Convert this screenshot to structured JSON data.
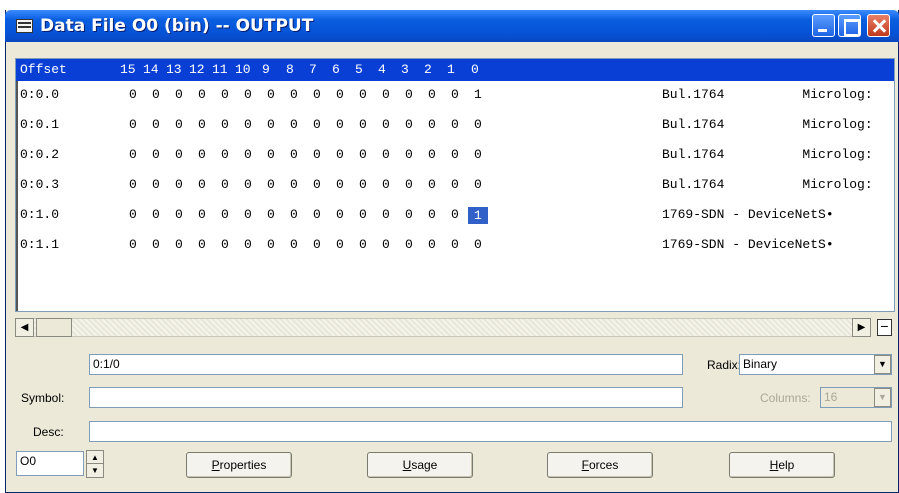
{
  "window": {
    "title": "Data File O0 (bin)  --  OUTPUT"
  },
  "table": {
    "header": {
      "offset": "Offset",
      "bits": [
        "15",
        "14",
        "13",
        "12",
        "11",
        "10",
        "9",
        "8",
        "7",
        "6",
        "5",
        "4",
        "3",
        "2",
        "1",
        "0"
      ]
    },
    "rows": [
      {
        "offset": "0:0.0",
        "bits": [
          "0",
          "0",
          "0",
          "0",
          "0",
          "0",
          "0",
          "0",
          "0",
          "0",
          "0",
          "0",
          "0",
          "0",
          "0",
          "1"
        ],
        "description": "Bul.1764          Microlog:"
      },
      {
        "offset": "0:0.1",
        "bits": [
          "0",
          "0",
          "0",
          "0",
          "0",
          "0",
          "0",
          "0",
          "0",
          "0",
          "0",
          "0",
          "0",
          "0",
          "0",
          "0"
        ],
        "description": "Bul.1764          Microlog:"
      },
      {
        "offset": "0:0.2",
        "bits": [
          "0",
          "0",
          "0",
          "0",
          "0",
          "0",
          "0",
          "0",
          "0",
          "0",
          "0",
          "0",
          "0",
          "0",
          "0",
          "0"
        ],
        "description": "Bul.1764          Microlog:"
      },
      {
        "offset": "0:0.3",
        "bits": [
          "0",
          "0",
          "0",
          "0",
          "0",
          "0",
          "0",
          "0",
          "0",
          "0",
          "0",
          "0",
          "0",
          "0",
          "0",
          "0"
        ],
        "description": "Bul.1764          Microlog:"
      },
      {
        "offset": "0:1.0",
        "bits": [
          "0",
          "0",
          "0",
          "0",
          "0",
          "0",
          "0",
          "0",
          "0",
          "0",
          "0",
          "0",
          "0",
          "0",
          "0",
          "1"
        ],
        "description": "1769-SDN - DeviceNetS•"
      },
      {
        "offset": "0:1.1",
        "bits": [
          "0",
          "0",
          "0",
          "0",
          "0",
          "0",
          "0",
          "0",
          "0",
          "0",
          "0",
          "0",
          "0",
          "0",
          "0",
          "0"
        ],
        "description": "1769-SDN - DeviceNetS•"
      }
    ],
    "selected_cell": {
      "row": 4,
      "bit": "0"
    }
  },
  "address_field": {
    "value": "0:1/0"
  },
  "radix": {
    "label": "Radix:",
    "value": "Binary"
  },
  "symbol": {
    "label": "Symbol:",
    "value": ""
  },
  "columns": {
    "label": "Columns:",
    "value": "16"
  },
  "desc": {
    "label": "Desc:",
    "value": ""
  },
  "file_number": {
    "value": "O0"
  },
  "buttons": {
    "properties": {
      "pre": "",
      "key": "P",
      "post": "roperties"
    },
    "usage": {
      "pre": "",
      "key": "U",
      "post": "sage"
    },
    "forces": {
      "pre": "",
      "key": "F",
      "post": "orces"
    },
    "help": {
      "pre": "",
      "key": "H",
      "post": "elp"
    }
  },
  "colors": {
    "title_bar": "#0653d8",
    "header_bg": "#0a3fd6",
    "selection": "#3161c8"
  }
}
